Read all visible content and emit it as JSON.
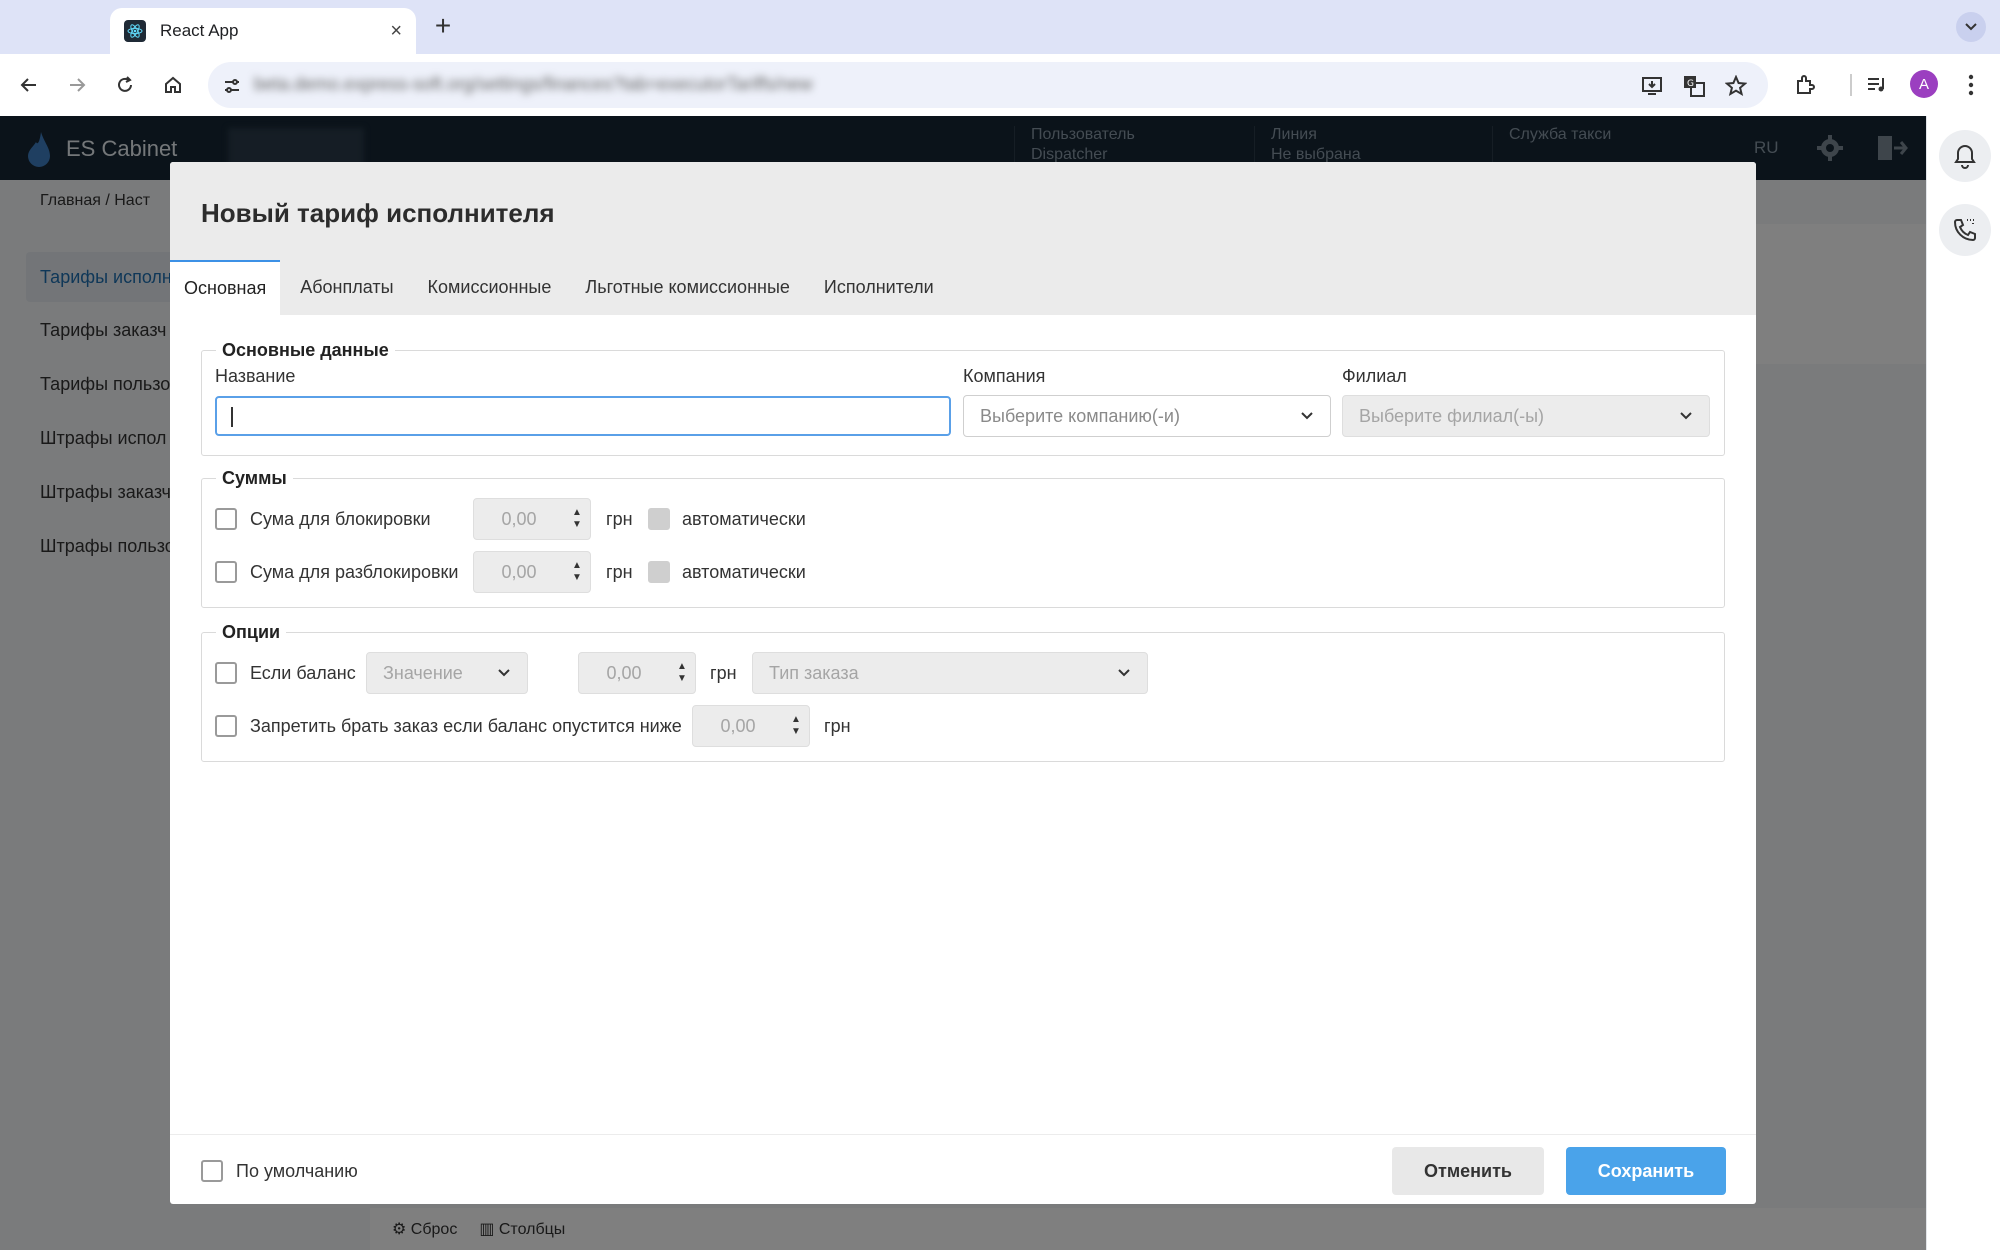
{
  "browser": {
    "tab_title": "React App",
    "tab_close": "×",
    "new_tab": "+",
    "address": "beta.demo.express-soft.org/settings/finances?tab=executorTariffs/new",
    "profile_initial": "A"
  },
  "app": {
    "logo_text": "ES Cabinet",
    "header": {
      "user_label": "Пользователь",
      "user_value": "Dispatcher",
      "line_label": "Линия",
      "line_value": "Не выбрана",
      "service_label": "Служба такси",
      "lang": "RU"
    },
    "breadcrumb": "Главная  /  Наст",
    "sidebar": [
      {
        "label": "Тарифы исполн"
      },
      {
        "label": "Тарифы заказч"
      },
      {
        "label": "Тарифы пользо"
      },
      {
        "label": "Штрафы испол"
      },
      {
        "label": "Штрафы заказч"
      },
      {
        "label": "Штрафы пользо"
      }
    ],
    "footer": {
      "reset": "Сброс",
      "columns": "Столбцы"
    }
  },
  "modal": {
    "title": "Новый тариф исполнителя",
    "tabs": [
      {
        "label": "Основная"
      },
      {
        "label": "Абонплаты"
      },
      {
        "label": "Комиссионные"
      },
      {
        "label": "Льготные комиссионные"
      },
      {
        "label": "Исполнители"
      }
    ],
    "basic": {
      "legend": "Основные данные",
      "name_label": "Название",
      "name_value": "",
      "company_label": "Компания",
      "company_placeholder": "Выберите компанию(-и)",
      "branch_label": "Филиал",
      "branch_placeholder": "Выберите филиал(-ы)"
    },
    "sums": {
      "legend": "Суммы",
      "rows": [
        {
          "label": "Сума для блокировки",
          "value": "0,00",
          "unit": "грн",
          "auto": "автоматически"
        },
        {
          "label": "Сума для разблокировки",
          "value": "0,00",
          "unit": "грн",
          "auto": "автоматически"
        }
      ]
    },
    "options": {
      "legend": "Опции",
      "balance_label": "Если баланс",
      "balance_select": "Значение",
      "balance_value": "0,00",
      "balance_unit": "грн",
      "order_type": "Тип заказа",
      "forbid_label": "Запретить брать заказ если баланс опустится ниже",
      "forbid_value": "0,00",
      "forbid_unit": "грн"
    },
    "footer": {
      "default_label": "По умолчанию",
      "cancel": "Отменить",
      "save": "Сохранить"
    }
  }
}
